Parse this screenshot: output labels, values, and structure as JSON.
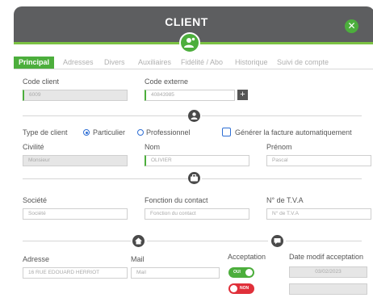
{
  "header": {
    "title": "CLIENT",
    "close_glyph": "✕",
    "accent": "#4cae3c",
    "background": "#5d5e60"
  },
  "tabs": [
    {
      "label": "Principal",
      "active": true
    },
    {
      "label": "Adresses",
      "active": false
    },
    {
      "label": "Divers",
      "active": false
    },
    {
      "label": "Auxiliaires",
      "active": false
    },
    {
      "label": "Fidélité / Abo",
      "active": false
    },
    {
      "label": "Historique",
      "active": false
    },
    {
      "label": "Suivi de compte",
      "active": false
    }
  ],
  "ident": {
    "code_client_label": "Code client",
    "code_client_value": "6009",
    "code_externe_label": "Code externe",
    "code_externe_value": "40843985",
    "plus_glyph": "+"
  },
  "personne": {
    "type_label": "Type de client",
    "particulier": "Particulier",
    "professionnel": "Professionnel",
    "selected": "Particulier",
    "facture_label": "Générer la facture automatiquement",
    "civilite_label": "Civilité",
    "civilite_value": "Monsieur",
    "nom_label": "Nom",
    "nom_value": "OLIVIER",
    "prenom_label": "Prénom",
    "prenom_placeholder": "Pascal"
  },
  "societe": {
    "societe_label": "Société",
    "societe_placeholder": "Société",
    "fonction_label": "Fonction du contact",
    "fonction_placeholder": "Fonction du contact",
    "tva_label": "N° de T.V.A",
    "tva_placeholder": "N° de T.V.A"
  },
  "contact": {
    "adresse_label": "Adresse",
    "adresse_value": "16 RUE EDOUARD HERRIOT",
    "mail_label": "Mail",
    "mail_placeholder": "Mail",
    "acceptation_label": "Acceptation",
    "oui_label": "OUI",
    "non_label": "NON",
    "date_label": "Date modif acceptation",
    "date_value": "03/02/2023",
    "date_value_2": ""
  },
  "icons": {
    "header": "user-gear-icon",
    "identity": "user-icon",
    "company": "briefcase-icon",
    "address": "home-icon",
    "chat": "chat-bubble-icon"
  }
}
